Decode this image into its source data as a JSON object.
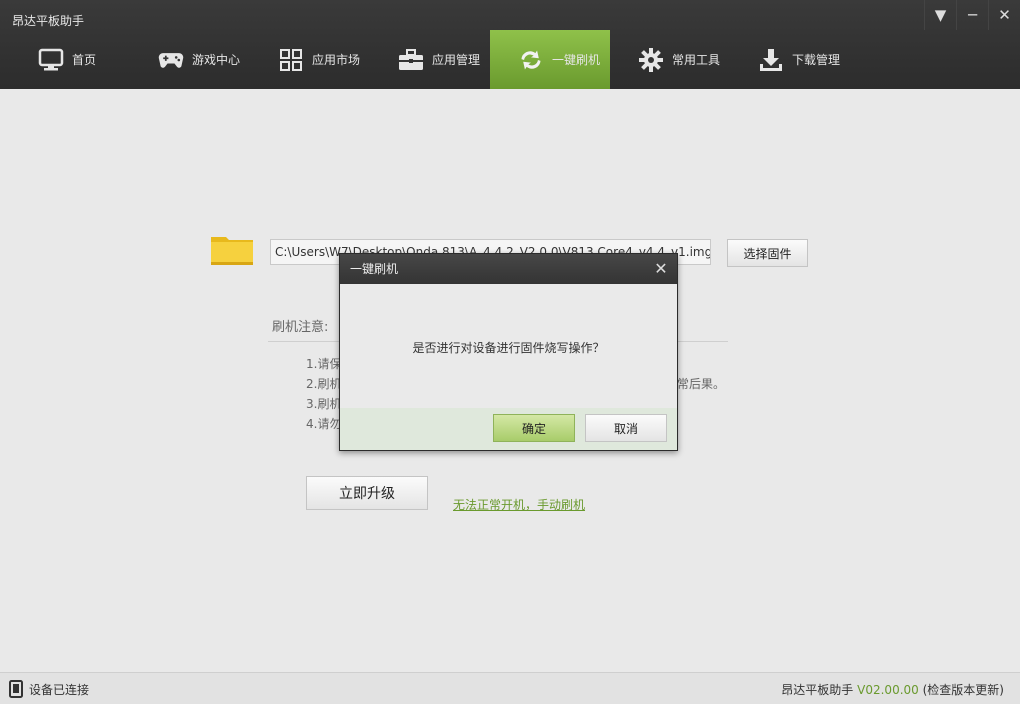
{
  "app": {
    "title": "昂达平板助手"
  },
  "window_controls": [
    "▼",
    "─",
    "✕"
  ],
  "nav": [
    {
      "label": "首页",
      "icon": "monitor-icon"
    },
    {
      "label": "游戏中心",
      "icon": "gamepad-icon"
    },
    {
      "label": "应用市场",
      "icon": "grid-icon"
    },
    {
      "label": "应用管理",
      "icon": "toolbox-icon"
    },
    {
      "label": "一键刷机",
      "icon": "flash-icon",
      "active": true
    },
    {
      "label": "常用工具",
      "icon": "gear-icon"
    },
    {
      "label": "下载管理",
      "icon": "download-icon"
    }
  ],
  "firmware": {
    "path": "C:\\Users\\W7\\Desktop\\Onda 813\\A_4.4.2_V2.0.0\\V813 Core4_v4.4_v1.img",
    "choose_label": "选择固件"
  },
  "notes": {
    "title": "刷机注意:",
    "items": [
      "1.请保",
      "2.刷机",
      "3.刷机",
      "4.请勿"
    ],
    "trailing": "常后果。"
  },
  "upgrade_label": "立即升级",
  "manual_link": "无法正常开机，手动刷机",
  "dialog": {
    "title": "一键刷机",
    "message": "是否进行对设备进行固件烧写操作？",
    "ok": "确定",
    "cancel": "取消"
  },
  "status": {
    "device": "设备已连接",
    "app_name": "昂达平板助手",
    "version": "V02.00.00",
    "check": "(检查版本更新)"
  },
  "colors": {
    "accent": "#7fb23e",
    "topbar": "#333333",
    "link": "#6a9a2e"
  }
}
